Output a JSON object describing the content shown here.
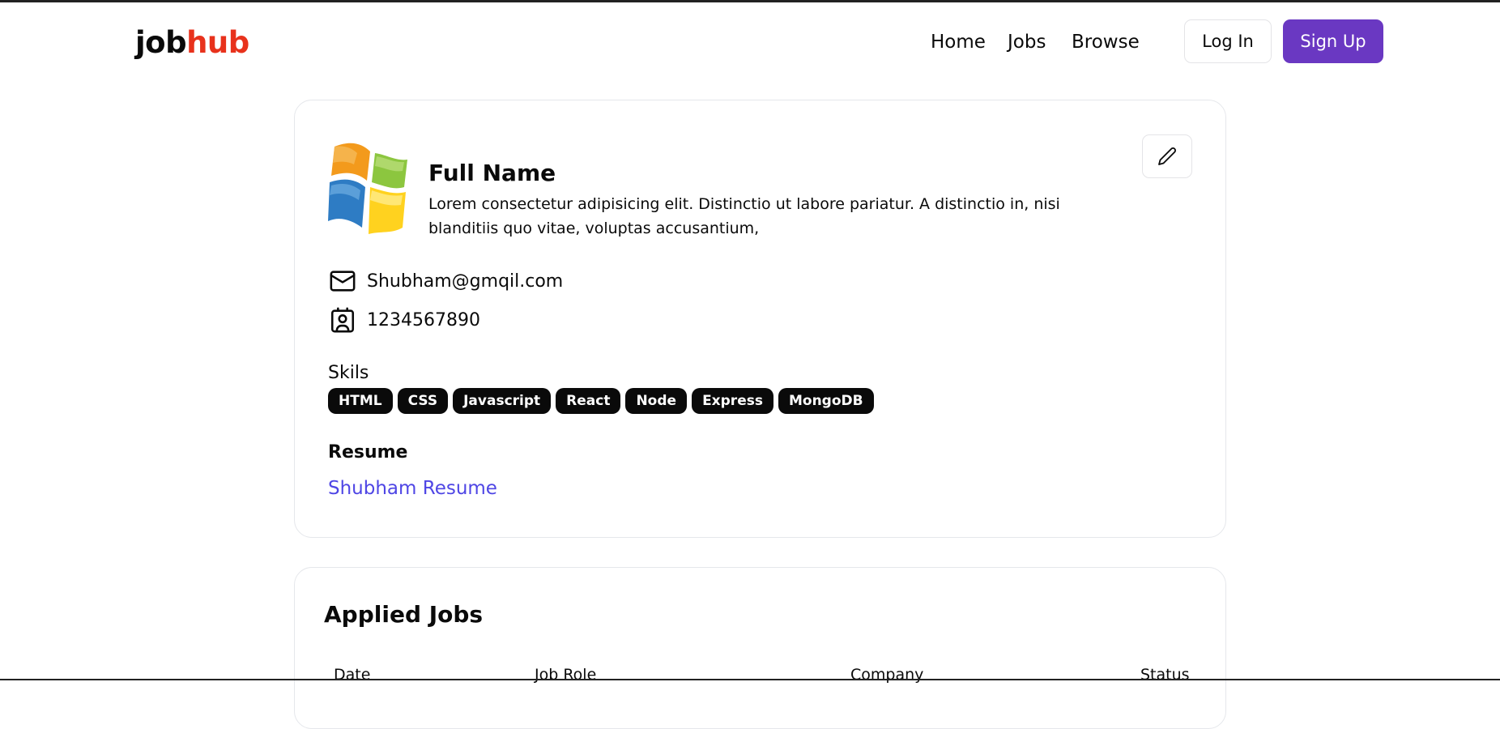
{
  "header": {
    "logo_part1": "job",
    "logo_part2": "hub",
    "logo_accent_color": "#e8321c",
    "nav": [
      "Home",
      "Jobs",
      "Browse"
    ],
    "login_label": "Log In",
    "signup_label": "Sign Up",
    "signup_color": "#6a38c2"
  },
  "profile": {
    "avatar_icon": "windows-logo-icon",
    "edit_icon": "pencil-icon",
    "full_name": "Full Name",
    "bio": "Lorem consectetur adipisicing elit. Distinctio ut labore pariatur. A distinctio in, nisi blanditiis quo vitae, voluptas accusantium,",
    "email_icon": "mail-icon",
    "email": "Shubham@gmqil.com",
    "phone_icon": "contact-icon",
    "phone": "1234567890",
    "skills_label": "Skils",
    "skills": [
      "HTML",
      "CSS",
      "Javascript",
      "React",
      "Node",
      "Express",
      "MongoDB"
    ],
    "resume_label": "Resume",
    "resume_link": "Shubham Resume",
    "link_color": "#4f46e5"
  },
  "applied": {
    "title": "Applied Jobs",
    "columns": [
      "Date",
      "Job Role",
      "Company",
      "Status"
    ]
  }
}
